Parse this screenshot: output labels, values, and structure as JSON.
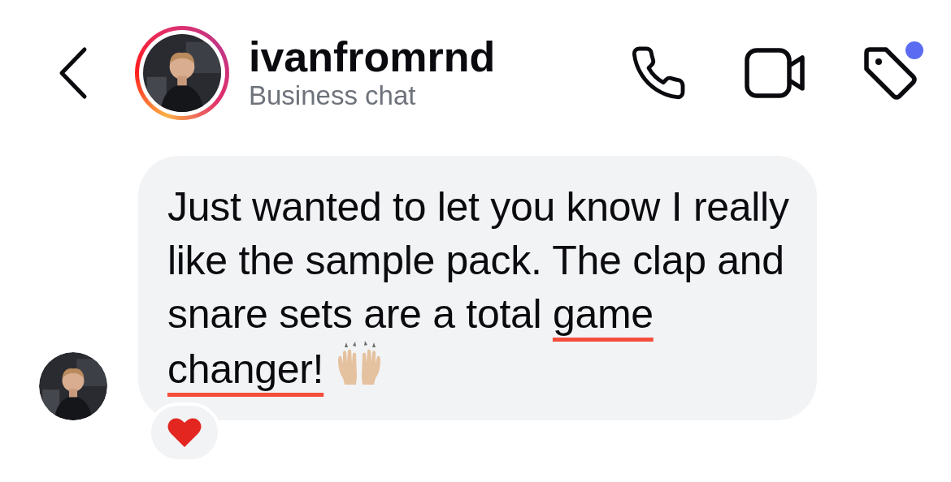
{
  "header": {
    "username": "ivanfromrnd",
    "subtitle": "Business chat",
    "story_ring": true,
    "tag_unread": true
  },
  "message": {
    "text": "Just wanted to let you know I really like the sample pack. The clap and snare sets are a total ",
    "underlined": "game changer!",
    "emoji": {
      "kind": "raised-hands"
    },
    "reaction": {
      "kind": "heart"
    }
  }
}
